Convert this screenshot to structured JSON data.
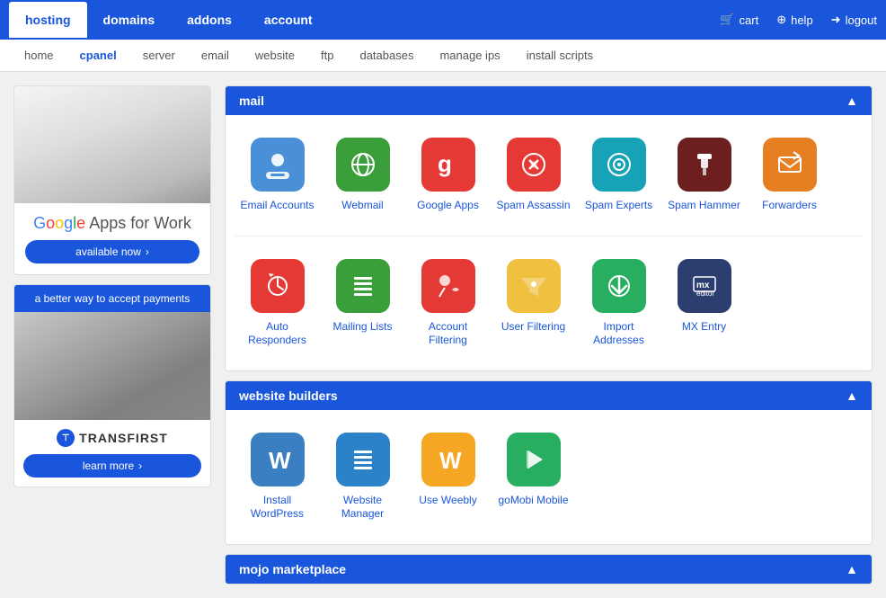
{
  "topNav": {
    "items": [
      {
        "label": "hosting",
        "active": true
      },
      {
        "label": "domains",
        "active": false
      },
      {
        "label": "addons",
        "active": false
      },
      {
        "label": "account",
        "active": false
      }
    ],
    "right": [
      {
        "label": "cart",
        "icon": "🛒"
      },
      {
        "label": "help",
        "icon": "⊕"
      },
      {
        "label": "logout",
        "icon": "➜"
      }
    ]
  },
  "secondNav": {
    "items": [
      {
        "label": "home",
        "active": false
      },
      {
        "label": "cpanel",
        "active": true
      },
      {
        "label": "server",
        "active": false
      },
      {
        "label": "email",
        "active": false
      },
      {
        "label": "website",
        "active": false
      },
      {
        "label": "ftp",
        "active": false
      },
      {
        "label": "databases",
        "active": false
      },
      {
        "label": "manage ips",
        "active": false
      },
      {
        "label": "install scripts",
        "active": false
      }
    ]
  },
  "sidebar": {
    "ad1": {
      "title": "Google Apps for Work",
      "button": "available now"
    },
    "ad2": {
      "header": "a better way to accept payments",
      "brand": "TRANSFIRST",
      "button": "learn more"
    }
  },
  "sections": [
    {
      "id": "mail",
      "title": "mail",
      "icons": [
        {
          "label": "Email Accounts",
          "bg": "bg-blue",
          "symbol": "👤"
        },
        {
          "label": "Webmail",
          "bg": "bg-green",
          "symbol": "🌐"
        },
        {
          "label": "Google Apps",
          "bg": "bg-green",
          "symbol": "G"
        },
        {
          "label": "Spam Assassin",
          "bg": "bg-red",
          "symbol": "🎯"
        },
        {
          "label": "Spam Experts",
          "bg": "bg-teal",
          "symbol": "⚙"
        },
        {
          "label": "Spam Hammer",
          "bg": "bg-darkred",
          "symbol": "🔑"
        },
        {
          "label": "Forwarders",
          "bg": "bg-orange",
          "symbol": "✉"
        },
        {
          "label": "Auto Responders",
          "bg": "bg-red",
          "symbol": "⏱"
        },
        {
          "label": "Mailing Lists",
          "bg": "bg-green",
          "symbol": "☰"
        },
        {
          "label": "Account Filtering",
          "bg": "bg-red",
          "symbol": "🎧"
        },
        {
          "label": "User Filtering",
          "bg": "bg-yellow",
          "symbol": "⚙"
        },
        {
          "label": "Import Addresses",
          "bg": "bg-darkgreen",
          "symbol": "⬇"
        },
        {
          "label": "MX Entry",
          "bg": "bg-darkblue",
          "symbol": "✉"
        }
      ]
    },
    {
      "id": "website-builders",
      "title": "website builders",
      "icons": [
        {
          "label": "Install WordPress",
          "bg": "bg-wordpress",
          "symbol": "W"
        },
        {
          "label": "Website Manager",
          "bg": "bg-manager",
          "symbol": "≡"
        },
        {
          "label": "Use Weebly",
          "bg": "bg-weebly",
          "symbol": "W"
        },
        {
          "label": "goMobi Mobile",
          "bg": "bg-gomobi",
          "symbol": "▷"
        }
      ]
    },
    {
      "id": "mojo-marketplace",
      "title": "mojo marketplace",
      "icons": []
    }
  ]
}
